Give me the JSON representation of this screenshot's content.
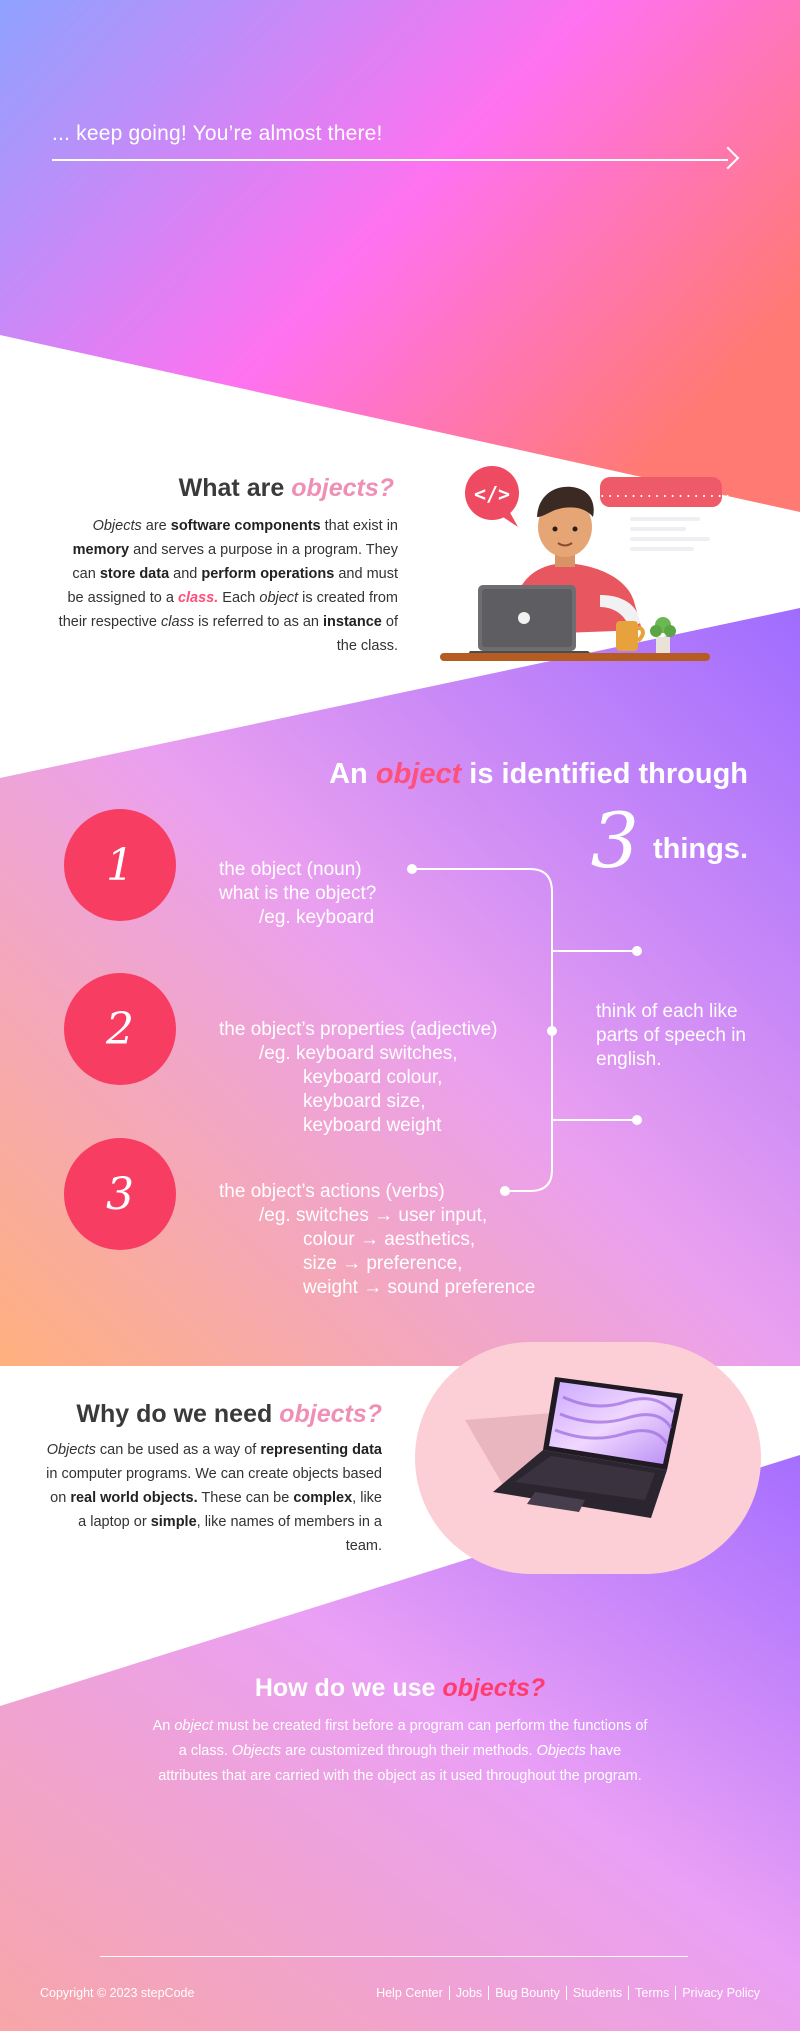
{
  "hero": {
    "progress_text": "... keep going! You’re almost there!"
  },
  "what": {
    "title_prefix": "What are",
    "title_em": "objects?",
    "body": [
      {
        "t": "Objects",
        "s": "i"
      },
      {
        "t": " are "
      },
      {
        "t": "software components",
        "s": "b"
      },
      {
        "t": " that exist in "
      },
      {
        "t": "memory",
        "s": "b"
      },
      {
        "t": " and serves a purpose in a program. They can "
      },
      {
        "t": "store data",
        "s": "b"
      },
      {
        "t": " and "
      },
      {
        "t": "perform operations",
        "s": "b"
      },
      {
        "t": " and must be assigned to a "
      },
      {
        "t": "class.",
        "s": "em"
      },
      {
        "t": " Each "
      },
      {
        "t": "object",
        "s": "i"
      },
      {
        "t": " is created from their respective "
      },
      {
        "t": "class",
        "s": "i"
      },
      {
        "t": " is referred to as an "
      },
      {
        "t": "instance",
        "s": "b"
      },
      {
        "t": " of the class."
      }
    ],
    "illustration": {
      "bubble_left": "</>",
      "bubble_right": "{..................}"
    }
  },
  "identified": {
    "title_prefix": "An",
    "title_em": "object",
    "title_suffix": "is identified through",
    "three_num": "3",
    "three_word": "things.",
    "note": "think of each like parts of speech in english.",
    "items": [
      {
        "num": "1",
        "lines": [
          "the object (noun)",
          "what is the object?",
          "/eg. keyboard"
        ]
      },
      {
        "num": "2",
        "lines": [
          "the object’s properties (adjective)",
          "/eg.  keyboard switches,",
          "keyboard colour,",
          "keyboard size,",
          "keyboard weight"
        ]
      },
      {
        "num": "3",
        "lines": [
          "the object’s actions (verbs)",
          "/eg. switches → user input,",
          "colour → aesthetics,",
          "size → preference,",
          "weight → sound preference"
        ]
      }
    ]
  },
  "why": {
    "title_prefix": "Why do we need",
    "title_em": "objects?",
    "body": [
      {
        "t": "Objects",
        "s": "i"
      },
      {
        "t": " can be used as a way of "
      },
      {
        "t": "representing data",
        "s": "b"
      },
      {
        "t": " in computer programs. We can create objects based on "
      },
      {
        "t": "real world objects.",
        "s": "b"
      },
      {
        "t": " These can be "
      },
      {
        "t": "complex",
        "s": "b"
      },
      {
        "t": ", like a laptop or "
      },
      {
        "t": "simple",
        "s": "b"
      },
      {
        "t": ", like names of members in a team."
      }
    ]
  },
  "how": {
    "title_prefix": "How do we use",
    "title_em": "objects?",
    "body": [
      {
        "t": "An "
      },
      {
        "t": "object",
        "s": "i"
      },
      {
        "t": " must be created first before a program can perform the functions of a class. "
      },
      {
        "t": "Objects",
        "s": "i"
      },
      {
        "t": " are customized through their methods. "
      },
      {
        "t": "Objects",
        "s": "i"
      },
      {
        "t": " have attributes that are carried with the object as it used throughout the program."
      }
    ]
  },
  "footer": {
    "copyright": "Copyright © 2023 stepCode",
    "links": [
      "Help Center",
      "Jobs",
      "Bug Bounty",
      "Students",
      "Terms",
      "Privacy Policy"
    ]
  },
  "colors": {
    "accent": "#f83d63",
    "pink": "#ff4f7b",
    "lavender": "#b57bff"
  }
}
